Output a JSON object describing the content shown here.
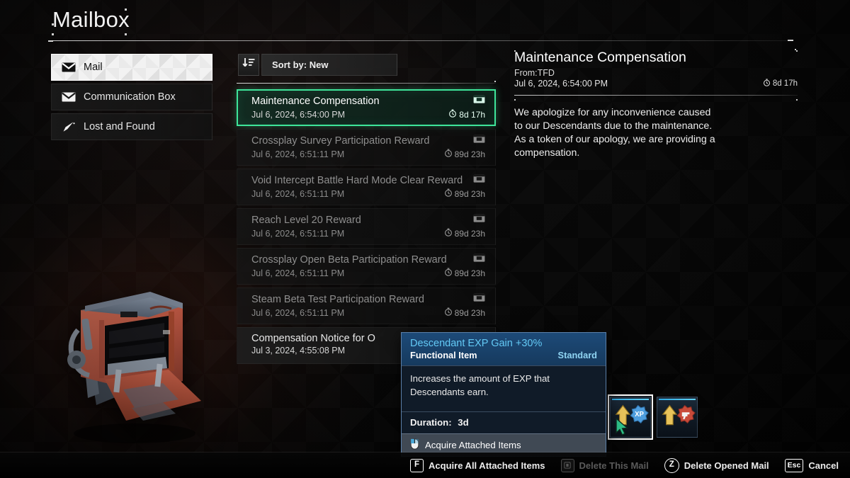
{
  "page": {
    "title": "Mailbox"
  },
  "sidebar": {
    "items": [
      {
        "label": "Mail",
        "icon": "envelope-icon",
        "active": true
      },
      {
        "label": "Communication Box",
        "icon": "envelope-icon",
        "active": false
      },
      {
        "label": "Lost and Found",
        "icon": "umbrella-icon",
        "active": false
      }
    ]
  },
  "sort": {
    "icon": "sort-descending-icon",
    "label": "Sort by: New"
  },
  "mail_list": [
    {
      "subject": "Maintenance Compensation",
      "date": "Jul 6, 2024, 6:54:00 PM",
      "expiry": "8d 17h",
      "state": "selected",
      "attachment_icon": "attachment-box-icon",
      "timer_icon": "stopwatch-icon"
    },
    {
      "subject": "Crossplay Survey Participation Reward",
      "date": "Jul 6, 2024, 6:51:11 PM",
      "expiry": "89d 23h",
      "state": "read",
      "attachment_icon": "attachment-box-icon",
      "timer_icon": "stopwatch-icon"
    },
    {
      "subject": "Void Intercept Battle Hard Mode Clear Reward",
      "date": "Jul 6, 2024, 6:51:11 PM",
      "expiry": "89d 23h",
      "state": "read",
      "attachment_icon": "attachment-box-icon",
      "timer_icon": "stopwatch-icon"
    },
    {
      "subject": "Reach Level 20 Reward",
      "date": "Jul 6, 2024, 6:51:11 PM",
      "expiry": "89d 23h",
      "state": "read",
      "attachment_icon": "attachment-box-icon",
      "timer_icon": "stopwatch-icon"
    },
    {
      "subject": "Crossplay Open Beta Participation Reward",
      "date": "Jul 6, 2024, 6:51:11 PM",
      "expiry": "89d 23h",
      "state": "read",
      "attachment_icon": "attachment-box-icon",
      "timer_icon": "stopwatch-icon"
    },
    {
      "subject": "Steam Beta Test Participation Reward",
      "date": "Jul 6, 2024, 6:51:11 PM",
      "expiry": "89d 23h",
      "state": "read",
      "attachment_icon": "attachment-box-icon",
      "timer_icon": "stopwatch-icon"
    },
    {
      "subject": "Compensation Notice for O",
      "date": "Jul 3, 2024, 4:55:08 PM",
      "expiry": "",
      "state": "unread",
      "attachment_icon": "",
      "timer_icon": ""
    }
  ],
  "detail": {
    "title": "Maintenance Compensation",
    "from": "From:TFD",
    "date": "Jul 6, 2024, 6:54:00 PM",
    "expiry": "8d 17h",
    "body": "We apologize for any inconvenience caused to our Descendants due to the maintenance. As a token of our apology, we are providing a compensation.",
    "timer_icon": "stopwatch-icon"
  },
  "attachments": [
    {
      "name": "Descendant EXP Gain +30%",
      "icon": "xp-boost-icon",
      "focused": true
    },
    {
      "name": "Weapon Boost",
      "icon": "weapon-boost-icon",
      "focused": false
    }
  ],
  "tooltip": {
    "item_name": "Descendant EXP Gain +30%",
    "item_type": "Functional Item",
    "rarity": "Standard",
    "description": "Increases the amount of EXP that Descendants earn.",
    "duration_label": "Duration:",
    "duration_value": "3d",
    "action_label": "Acquire Attached Items",
    "action_icon": "mouse-left-click-icon",
    "accent_color": "#63c9f5"
  },
  "bottom_hints": [
    {
      "key": "F",
      "label": "Acquire All Attached Items",
      "shape": "square",
      "enabled": true
    },
    {
      "key": "",
      "label": "Delete This Mail",
      "shape": "square",
      "enabled": false
    },
    {
      "key": "Z",
      "label": "Delete Opened Mail",
      "shape": "round",
      "enabled": true
    },
    {
      "key": "Esc",
      "label": "Cancel",
      "shape": "wide",
      "enabled": true
    }
  ],
  "colors": {
    "selection_green": "#3ee59a",
    "tooltip_blue": "#1d4a78",
    "accent_cyan": "#63c9f5"
  }
}
